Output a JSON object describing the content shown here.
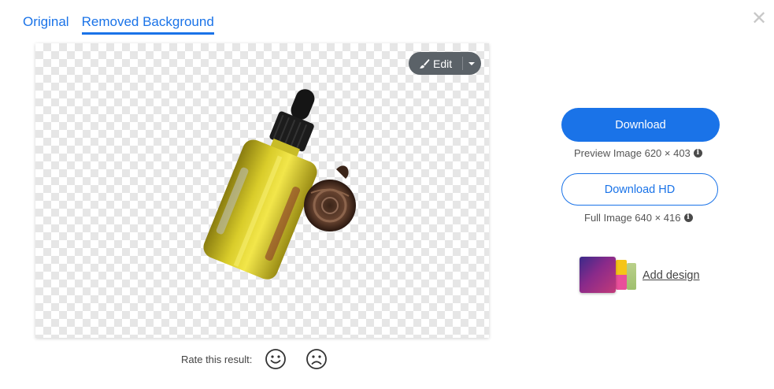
{
  "tabs": [
    {
      "label": "Original",
      "active": false
    },
    {
      "label": "Removed Background",
      "active": true
    }
  ],
  "canvas": {
    "edit_label": "Edit"
  },
  "rating": {
    "label": "Rate this result:"
  },
  "downloads": {
    "primary_label": "Download",
    "preview_info": "Preview Image 620 × 403",
    "hd_label": "Download HD",
    "full_info": "Full Image 640 × 416"
  },
  "add_design": {
    "label": "Add design"
  },
  "colors": {
    "accent": "#1a73e8",
    "edit_button": "#5b6268",
    "checker": "#e6e6e6"
  },
  "icons": [
    "close-icon",
    "brush-icon",
    "caret-down-icon",
    "smile-icon",
    "frown-icon",
    "info-icon"
  ]
}
